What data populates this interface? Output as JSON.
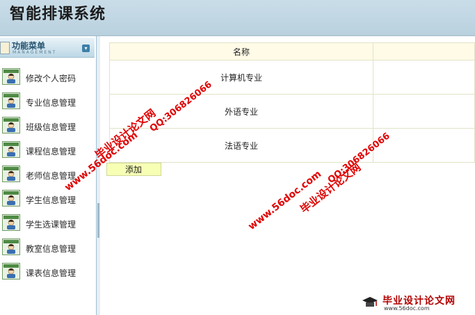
{
  "app": {
    "title": "智能排课系统"
  },
  "sidebar": {
    "header_title": "功能菜单",
    "header_subtitle": "MANAGEMENT",
    "items": [
      {
        "label": "修改个人密码"
      },
      {
        "label": "专业信息管理"
      },
      {
        "label": "班级信息管理"
      },
      {
        "label": "课程信息管理"
      },
      {
        "label": "老师信息管理"
      },
      {
        "label": "学生信息管理"
      },
      {
        "label": "学生选课管理"
      },
      {
        "label": "教室信息管理"
      },
      {
        "label": "课表信息管理"
      }
    ]
  },
  "main": {
    "table": {
      "header": "名称",
      "rows": [
        "计算机专业",
        "外语专业",
        "法语专业"
      ]
    },
    "add_label": "添加"
  },
  "watermark": {
    "site": "www.56doc.com",
    "name": "毕业设计论文网",
    "qq": "QQ:306826066"
  },
  "logo": {
    "name": "毕业设计论文网",
    "url": "www.56doc.com"
  },
  "colors": {
    "header_bg": "#c1d8e4",
    "watermark": "#e00000",
    "add_button_bg": "#f7ffb5",
    "table_header_bg": "#fffbe7"
  }
}
